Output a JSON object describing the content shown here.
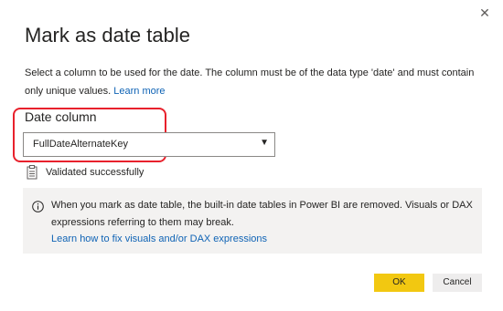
{
  "dialog": {
    "title": "Mark as date table",
    "description": "Select a column to be used for the date. The column must be of the data type 'date' and must contain only unique values.",
    "learn_more": "Learn more",
    "close_glyph": "✕"
  },
  "date_column": {
    "label": "Date column",
    "selected": "FullDateAlternateKey"
  },
  "validation": {
    "status": "Validated successfully",
    "icon": "clipboard-check-icon"
  },
  "info": {
    "text": "When you mark as date table, the built-in date tables in Power BI are removed. Visuals or DAX expressions referring to them may break.",
    "link": "Learn how to fix visuals and/or DAX expressions",
    "icon": "info-icon"
  },
  "buttons": {
    "ok": "OK",
    "cancel": "Cancel"
  },
  "colors": {
    "accent": "#f2c811",
    "link": "#0f63b5",
    "highlight": "#e8212c",
    "panel": "#f3f2f1"
  }
}
